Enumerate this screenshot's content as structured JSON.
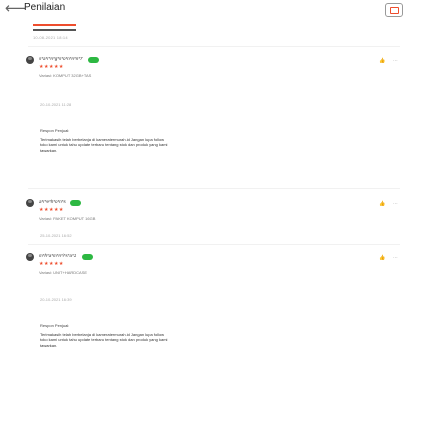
{
  "header": {
    "back_icon": "arrow-left-icon",
    "title": "Penilaian",
    "help_icon": "chat-help-icon",
    "accent": "#ee4d2d"
  },
  "top_timestamp": "10-08-2021 18:14",
  "reviews": [
    {
      "username": "s*a*r*n*g*s*o*n*n*n*7",
      "stars": "★★★★★",
      "variant": "Variasi: KOMPUT 32GB+TAS",
      "date": "20-10-2021 11:28",
      "seller_response": {
        "title": "Respon Penjual:",
        "text": "Terimakasih telah berbelanja di kameratermurah.id Jangan lupa follow toko kami untuk tahu update terbaru tentang stok dan produk yang kami tawarkan."
      }
    },
    {
      "username": "a*r*e*h*o*n*s",
      "stars": "★★★★★",
      "variant": "Variasi: PAKET KOMPUT 16GB",
      "date": "25-10-2021 16:52"
    },
    {
      "username": "m*h*a*m*n*i*s*a*1",
      "stars": "★★★★★",
      "variant": "Variasi: UNIT+HARDCASE",
      "date": "20-10-2021 16:39",
      "seller_response": {
        "title": "Respon Penjual:",
        "text": "Terimakasih telah berbelanja di kameratermurah.id Jangan lupa follow toko kami untuk tahu update terbaru tentang stok dan produk yang kami tawarkan."
      }
    }
  ],
  "icons": {
    "like": "thumbs-up-icon",
    "more": "more-dots-icon"
  },
  "colors": {
    "star": "#ee4d2d",
    "badge": "#2db842"
  }
}
